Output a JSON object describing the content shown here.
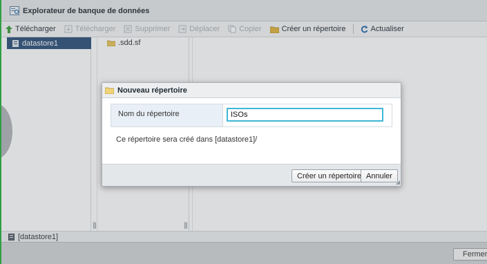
{
  "window": {
    "title": "Explorateur de banque de données"
  },
  "toolbar": {
    "items": [
      {
        "label": "Télécharger",
        "icon": "upload-icon",
        "enabled": true
      },
      {
        "label": "Télécharger",
        "icon": "download-icon",
        "enabled": false
      },
      {
        "label": "Supprimer",
        "icon": "delete-icon",
        "enabled": false
      },
      {
        "label": "Déplacer",
        "icon": "move-icon",
        "enabled": false
      },
      {
        "label": "Copier",
        "icon": "copy-icon",
        "enabled": false
      },
      {
        "label": "Créer un répertoire",
        "icon": "new-folder-icon",
        "enabled": true
      },
      {
        "label": "Actualiser",
        "icon": "refresh-icon",
        "enabled": true
      }
    ]
  },
  "tree": {
    "datastores": [
      {
        "label": "datastore1",
        "selected": true
      }
    ],
    "folders": [
      {
        "label": ".sdd.sf"
      }
    ],
    "scroll_marker": "|||"
  },
  "status": {
    "path": "[datastore1]"
  },
  "footer": {
    "close_label": "Fermer"
  },
  "dialog": {
    "title": "Nouveau répertoire",
    "field_label": "Nom du répertoire",
    "field_value": "ISOs",
    "info_text": "Ce répertoire sera créé dans [datastore1]/",
    "create_label": "Créer un répertoire",
    "cancel_label": "Annuler"
  },
  "colors": {
    "accent_green": "#2f9e44",
    "selection_blue": "#2b4f79",
    "input_focus": "#3fb6d6"
  }
}
